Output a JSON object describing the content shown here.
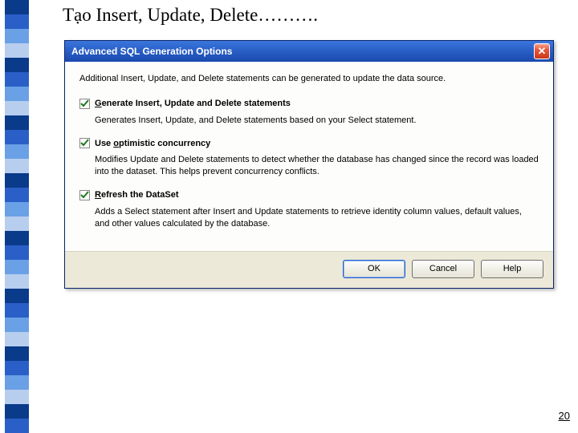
{
  "stripe_colors": [
    "#0a3a8a",
    "#2a5fc7",
    "#6aa0e6",
    "#b8ceee",
    "#0a3a8a",
    "#2a5fc7",
    "#6aa0e6",
    "#b8ceee",
    "#0a3a8a",
    "#2a5fc7",
    "#6aa0e6",
    "#b8ceee",
    "#0a3a8a",
    "#2a5fc7",
    "#6aa0e6",
    "#b8ceee",
    "#0a3a8a",
    "#2a5fc7",
    "#6aa0e6",
    "#b8ceee",
    "#0a3a8a",
    "#2a5fc7",
    "#6aa0e6",
    "#b8ceee",
    "#0a3a8a",
    "#2a5fc7",
    "#6aa0e6",
    "#b8ceee",
    "#0a3a8a",
    "#2a5fc7"
  ],
  "slide": {
    "title": "Tạo Insert, Update, Delete……….",
    "page_number": "20"
  },
  "dialog": {
    "title": "Advanced SQL Generation Options",
    "intro": "Additional Insert, Update, and Delete statements can be generated to update the data source.",
    "options": [
      {
        "checked": true,
        "label_pre": "",
        "label_under": "G",
        "label_post": "enerate Insert, Update and Delete statements",
        "desc": "Generates Insert, Update, and Delete statements based on your Select statement."
      },
      {
        "checked": true,
        "label_pre": "Use ",
        "label_under": "o",
        "label_post": "ptimistic concurrency",
        "desc": "Modifies Update and Delete statements to detect whether the database has changed since the record was loaded into the dataset. This helps prevent concurrency conflicts."
      },
      {
        "checked": true,
        "label_pre": "",
        "label_under": "R",
        "label_post": "efresh the DataSet",
        "desc": "Adds a Select statement after Insert and Update statements to retrieve identity column values, default values, and other values calculated by the database."
      }
    ],
    "buttons": {
      "ok": "OK",
      "cancel": "Cancel",
      "help": "Help"
    }
  }
}
